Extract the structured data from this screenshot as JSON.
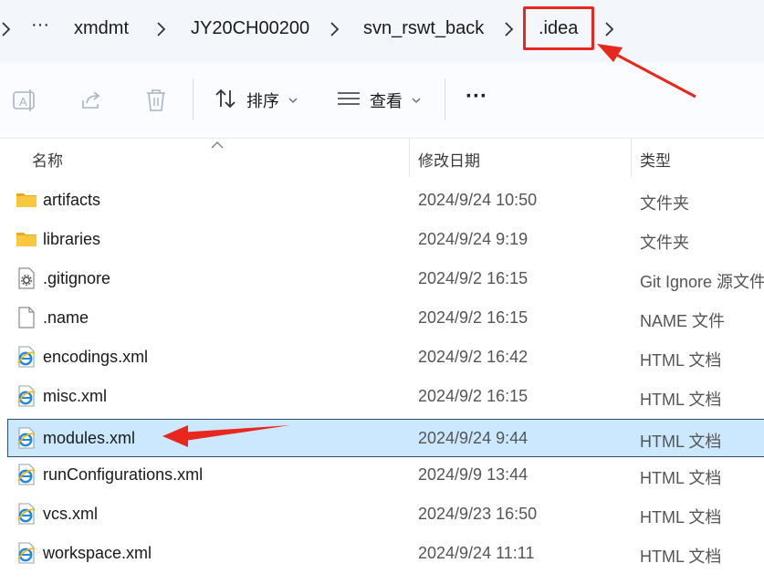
{
  "breadcrumb": {
    "overflow": "···",
    "items": [
      "xmdmt",
      "JY20CH00200",
      "svn_rswt_back",
      ".idea"
    ]
  },
  "toolbar": {
    "sort_label": "排序",
    "view_label": "查看",
    "more_label": "···"
  },
  "columns": {
    "name": "名称",
    "date": "修改日期",
    "type": "类型"
  },
  "files": [
    {
      "name": "artifacts",
      "date": "2024/9/24 10:50",
      "type": "文件夹",
      "icon": "folder-icon"
    },
    {
      "name": "libraries",
      "date": "2024/9/24 9:19",
      "type": "文件夹",
      "icon": "folder-icon"
    },
    {
      "name": ".gitignore",
      "date": "2024/9/2 16:15",
      "type": "Git Ignore 源文件",
      "icon": "settings-file-icon"
    },
    {
      "name": ".name",
      "date": "2024/9/2 16:15",
      "type": "NAME 文件",
      "icon": "blank-file-icon"
    },
    {
      "name": "encodings.xml",
      "date": "2024/9/2 16:42",
      "type": "HTML 文档",
      "icon": "ie-document-icon"
    },
    {
      "name": "misc.xml",
      "date": "2024/9/2 16:15",
      "type": "HTML 文档",
      "icon": "ie-document-icon"
    },
    {
      "name": "modules.xml",
      "date": "2024/9/24 9:44",
      "type": "HTML 文档",
      "icon": "ie-document-icon",
      "selected": true
    },
    {
      "name": "runConfigurations.xml",
      "date": "2024/9/9 13:44",
      "type": "HTML 文档",
      "icon": "ie-document-icon"
    },
    {
      "name": "vcs.xml",
      "date": "2024/9/23 16:50",
      "type": "HTML 文档",
      "icon": "ie-document-icon"
    },
    {
      "name": "workspace.xml",
      "date": "2024/9/24 11:11",
      "type": "HTML 文档",
      "icon": "ie-document-icon"
    }
  ],
  "colors": {
    "selection_bg": "#cce8ff",
    "selection_border": "#2b4f77",
    "annotation_red": "#e8271f",
    "folder_yellow": "#f8c93e"
  }
}
